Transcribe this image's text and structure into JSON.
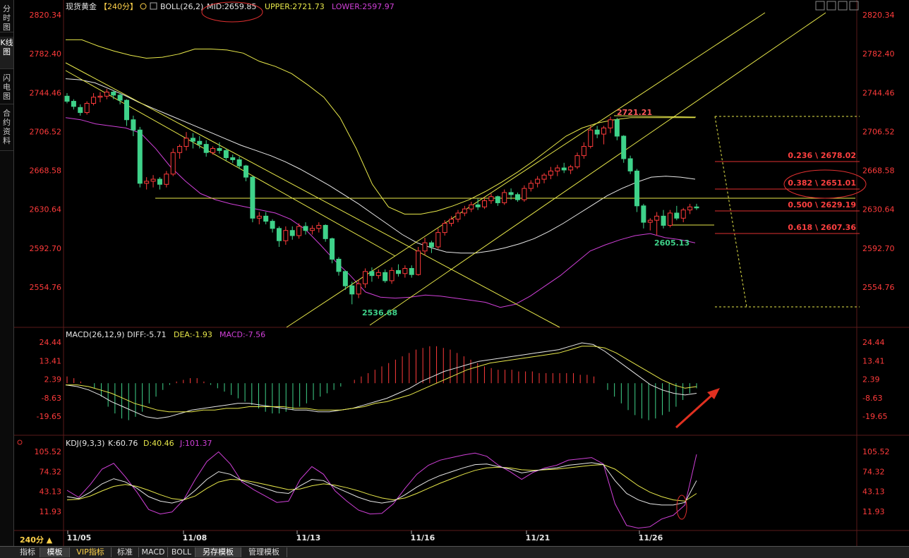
{
  "sidebar": {
    "tabs": [
      "分时图",
      "K线图",
      "闪电图",
      "合约资料"
    ]
  },
  "header": {
    "symbol": "现货黄金",
    "period": "【240分】",
    "boll_name": "BOLL(26,2)",
    "mid": "MID:2659.85",
    "upper": "UPPER:2721.73",
    "lower": "LOWER:2597.97"
  },
  "price_axis": {
    "labels": [
      "2820.34",
      "2782.40",
      "2744.46",
      "2706.52",
      "2668.58",
      "2630.64",
      "2592.70",
      "2554.76"
    ]
  },
  "macd": {
    "name": "MACD(26,12,9)",
    "diff": "DIFF:-5.71",
    "dea": "DEA:-1.93",
    "macd": "MACD:-7.56",
    "axis": [
      "24.44",
      "13.41",
      "2.39",
      "-8.63",
      "-19.65"
    ]
  },
  "kdj": {
    "name": "KDJ(9,3,3)",
    "k": "K:60.76",
    "d": "D:40.46",
    "j": "J:101.37",
    "axis": [
      "105.52",
      "74.32",
      "43.13",
      "11.93"
    ]
  },
  "dates": [
    "11/05",
    "11/08",
    "11/13",
    "11/16",
    "11/21",
    "11/26"
  ],
  "annotations": {
    "high": "2721.21",
    "low": "2536.68",
    "recent_low": "2605.13"
  },
  "fibonacci": [
    {
      "label": "0.236 \\ 2678.02"
    },
    {
      "label": "0.382 \\ 2651.01"
    },
    {
      "label": "0.500 \\ 2629.19"
    },
    {
      "label": "0.618 \\ 2607.36"
    }
  ],
  "period_label": "240分 ▲",
  "bottom_tabs": [
    "指标",
    "模板",
    "VIP指标",
    "标准",
    "MACD",
    "BOLL",
    "另存模板",
    "管理模板"
  ],
  "colors": {
    "up": "#ff3b3b",
    "down": "#3fd28a",
    "yellow": "#e8e84a",
    "magenta": "#d040d8",
    "white": "#e8e8e8",
    "axis": "#ff3b3b"
  },
  "chart_data": {
    "type": "candlestick",
    "candles": [
      [
        2741,
        2744,
        2734,
        2736
      ],
      [
        2736,
        2738,
        2728,
        2731
      ],
      [
        2730,
        2733,
        2722,
        2725
      ],
      [
        2725,
        2736,
        2723,
        2734
      ],
      [
        2734,
        2744,
        2732,
        2740
      ],
      [
        2740,
        2745,
        2735,
        2741
      ],
      [
        2741,
        2748,
        2738,
        2745
      ],
      [
        2745,
        2747,
        2738,
        2742
      ],
      [
        2742,
        2744,
        2733,
        2737
      ],
      [
        2737,
        2738,
        2712,
        2718
      ],
      [
        2718,
        2722,
        2702,
        2708
      ],
      [
        2708,
        2711,
        2652,
        2656
      ],
      [
        2656,
        2662,
        2650,
        2658
      ],
      [
        2658,
        2664,
        2652,
        2660
      ],
      [
        2660,
        2662,
        2650,
        2655
      ],
      [
        2655,
        2668,
        2652,
        2665
      ],
      [
        2665,
        2690,
        2663,
        2686
      ],
      [
        2686,
        2694,
        2680,
        2692
      ],
      [
        2692,
        2706,
        2688,
        2700
      ],
      [
        2700,
        2705,
        2690,
        2697
      ],
      [
        2697,
        2702,
        2690,
        2694
      ],
      [
        2694,
        2698,
        2682,
        2686
      ],
      [
        2686,
        2692,
        2684,
        2690
      ],
      [
        2690,
        2696,
        2685,
        2688
      ],
      [
        2688,
        2690,
        2678,
        2681
      ],
      [
        2681,
        2684,
        2676,
        2679
      ],
      [
        2679,
        2682,
        2670,
        2673
      ],
      [
        2673,
        2674,
        2658,
        2662
      ],
      [
        2662,
        2663,
        2618,
        2622
      ],
      [
        2622,
        2628,
        2616,
        2624
      ],
      [
        2624,
        2628,
        2616,
        2619
      ],
      [
        2619,
        2621,
        2608,
        2612
      ],
      [
        2612,
        2614,
        2594,
        2600
      ],
      [
        2600,
        2614,
        2596,
        2610
      ],
      [
        2610,
        2614,
        2601,
        2605
      ],
      [
        2605,
        2617,
        2602,
        2614
      ],
      [
        2614,
        2618,
        2606,
        2610
      ],
      [
        2610,
        2615,
        2606,
        2612
      ],
      [
        2612,
        2618,
        2608,
        2615
      ],
      [
        2615,
        2616,
        2599,
        2602
      ],
      [
        2602,
        2603,
        2578,
        2582
      ],
      [
        2582,
        2584,
        2566,
        2570
      ],
      [
        2570,
        2571,
        2552,
        2556
      ],
      [
        2556,
        2560,
        2538,
        2548
      ],
      [
        2548,
        2562,
        2544,
        2558
      ],
      [
        2558,
        2573,
        2554,
        2570
      ],
      [
        2570,
        2574,
        2560,
        2566
      ],
      [
        2566,
        2572,
        2563,
        2569
      ],
      [
        2569,
        2572,
        2559,
        2561
      ],
      [
        2561,
        2574,
        2558,
        2571
      ],
      [
        2571,
        2577,
        2565,
        2568
      ],
      [
        2568,
        2576,
        2564,
        2573
      ],
      [
        2573,
        2576,
        2564,
        2567
      ],
      [
        2567,
        2594,
        2566,
        2590
      ],
      [
        2590,
        2603,
        2586,
        2598
      ],
      [
        2598,
        2600,
        2588,
        2594
      ],
      [
        2594,
        2612,
        2592,
        2608
      ],
      [
        2608,
        2620,
        2605,
        2617
      ],
      [
        2617,
        2624,
        2614,
        2621
      ],
      [
        2621,
        2630,
        2618,
        2627
      ],
      [
        2627,
        2634,
        2624,
        2631
      ],
      [
        2631,
        2638,
        2628,
        2635
      ],
      [
        2635,
        2641,
        2630,
        2633
      ],
      [
        2633,
        2642,
        2631,
        2639
      ],
      [
        2639,
        2646,
        2636,
        2643
      ],
      [
        2643,
        2644,
        2634,
        2637
      ],
      [
        2637,
        2650,
        2635,
        2647
      ],
      [
        2647,
        2651,
        2640,
        2645
      ],
      [
        2645,
        2647,
        2638,
        2640
      ],
      [
        2640,
        2654,
        2638,
        2651
      ],
      [
        2651,
        2659,
        2648,
        2656
      ],
      [
        2656,
        2663,
        2652,
        2660
      ],
      [
        2660,
        2666,
        2656,
        2664
      ],
      [
        2664,
        2672,
        2660,
        2668
      ],
      [
        2668,
        2674,
        2663,
        2671
      ],
      [
        2671,
        2676,
        2666,
        2669
      ],
      [
        2669,
        2674,
        2665,
        2672
      ],
      [
        2672,
        2686,
        2670,
        2683
      ],
      [
        2683,
        2696,
        2680,
        2692
      ],
      [
        2692,
        2712,
        2690,
        2708
      ],
      [
        2708,
        2712,
        2700,
        2704
      ],
      [
        2704,
        2712,
        2694,
        2710
      ],
      [
        2710,
        2721,
        2705,
        2718
      ],
      [
        2718,
        2720,
        2698,
        2702
      ],
      [
        2702,
        2703,
        2676,
        2680
      ],
      [
        2680,
        2683,
        2665,
        2668
      ],
      [
        2668,
        2670,
        2628,
        2634
      ],
      [
        2634,
        2636,
        2612,
        2618
      ],
      [
        2618,
        2622,
        2610,
        2620
      ],
      [
        2620,
        2628,
        2605,
        2624
      ],
      [
        2624,
        2630,
        2612,
        2615
      ],
      [
        2615,
        2630,
        2613,
        2627
      ],
      [
        2627,
        2634,
        2620,
        2622
      ],
      [
        2622,
        2632,
        2618,
        2630
      ],
      [
        2630,
        2636,
        2626,
        2633
      ],
      [
        2633,
        2636,
        2630,
        2632
      ]
    ],
    "boll_upper": [
      2796,
      2796,
      2790,
      2785,
      2781,
      2778,
      2779,
      2782,
      2787,
      2787,
      2786,
      2783,
      2775,
      2770,
      2763,
      2752,
      2740,
      2720,
      2690,
      2655,
      2633,
      2626,
      2626,
      2629,
      2634,
      2640,
      2648,
      2657,
      2667,
      2678,
      2690,
      2702,
      2710,
      2715,
      2718,
      2720,
      2720,
      2720,
      2720,
      2720
    ],
    "boll_mid": [
      2758,
      2757,
      2754,
      2748,
      2742,
      2735,
      2729,
      2723,
      2717,
      2711,
      2705,
      2699,
      2693,
      2688,
      2683,
      2677,
      2670,
      2662,
      2654,
      2645,
      2636,
      2626,
      2616,
      2606,
      2598,
      2593,
      2589,
      2588,
      2588,
      2590,
      2593,
      2597,
      2602,
      2609,
      2617,
      2626,
      2635,
      2644,
      2651,
      2657,
      2662,
      2663,
      2662,
      2660
    ],
    "boll_lower": [
      2720,
      2718,
      2714,
      2712,
      2710,
      2705,
      2690,
      2672,
      2658,
      2646,
      2640,
      2636,
      2633,
      2630,
      2627,
      2621,
      2611,
      2596,
      2580,
      2566,
      2550,
      2545,
      2544,
      2545,
      2547,
      2546,
      2544,
      2542,
      2540,
      2535,
      2538,
      2546,
      2556,
      2566,
      2578,
      2590,
      2596,
      2601,
      2605,
      2607,
      2603,
      2601,
      2598
    ],
    "macd_hist": [
      4,
      3,
      1,
      0,
      -3,
      -8,
      -14,
      -18,
      -21,
      -22,
      -20,
      -17,
      -12,
      -8,
      -4,
      -1,
      1,
      2,
      3,
      3,
      1,
      -1,
      -3,
      -5,
      -7,
      -9,
      -11,
      -13,
      -15,
      -17,
      -18,
      -18,
      -17,
      -16,
      -14,
      -12,
      -10,
      -8,
      -6,
      -4,
      -2,
      0,
      2,
      4,
      6,
      8,
      10,
      12,
      14,
      16,
      18,
      20,
      21,
      22,
      22,
      21,
      20,
      18,
      16,
      14,
      12,
      10,
      9,
      8,
      8,
      8,
      7,
      7,
      7,
      6,
      6,
      6,
      6,
      6,
      6,
      5,
      5,
      4,
      0,
      -4,
      -8,
      -12,
      -16,
      -19,
      -21,
      -22,
      -21,
      -19,
      -17,
      -14,
      -10,
      -6,
      -3
    ],
    "macd_diff": [
      -1,
      -2,
      -4,
      -7,
      -11,
      -14,
      -17,
      -20,
      -21,
      -20,
      -18,
      -16,
      -15,
      -14,
      -13,
      -12,
      -12,
      -13,
      -14,
      -15,
      -16,
      -16,
      -17,
      -17,
      -16,
      -15,
      -13,
      -11,
      -9,
      -6,
      -3,
      1,
      4,
      7,
      9,
      11,
      13,
      14,
      15,
      16,
      17,
      18,
      19,
      20,
      22,
      24,
      23,
      19,
      14,
      9,
      4,
      -1,
      -4,
      -6,
      -7,
      -6
    ],
    "macd_dea": [
      -1,
      -1,
      -2,
      -4,
      -6,
      -9,
      -12,
      -14,
      -16,
      -17,
      -17,
      -17,
      -16,
      -16,
      -15,
      -15,
      -14,
      -14,
      -14,
      -14,
      -15,
      -15,
      -16,
      -16,
      -16,
      -15,
      -14,
      -12,
      -11,
      -9,
      -7,
      -4,
      -1,
      2,
      5,
      8,
      10,
      12,
      13,
      14,
      15,
      16,
      17,
      18,
      20,
      22,
      22,
      21,
      18,
      14,
      10,
      6,
      2,
      -1,
      -3,
      -2
    ],
    "kdj_k": [
      35,
      32,
      42,
      55,
      63,
      58,
      48,
      35,
      28,
      25,
      30,
      45,
      62,
      74,
      70,
      60,
      54,
      48,
      42,
      40,
      52,
      62,
      60,
      50,
      42,
      34,
      28,
      25,
      28,
      38,
      50,
      60,
      68,
      74,
      80,
      85,
      86,
      82,
      78,
      72,
      75,
      78,
      80,
      84,
      86,
      88,
      85,
      60,
      40,
      30,
      24,
      22,
      22,
      26,
      60
    ],
    "kdj_d": [
      30,
      31,
      36,
      44,
      51,
      54,
      51,
      45,
      38,
      32,
      30,
      36,
      48,
      58,
      62,
      61,
      58,
      54,
      50,
      46,
      47,
      52,
      55,
      53,
      49,
      44,
      38,
      33,
      30,
      33,
      40,
      48,
      56,
      63,
      70,
      76,
      80,
      81,
      80,
      77,
      76,
      77,
      78,
      80,
      82,
      84,
      85,
      78,
      65,
      52,
      42,
      35,
      30,
      28,
      40
    ],
    "kdj_j": [
      45,
      34,
      54,
      78,
      87,
      66,
      42,
      15,
      8,
      11,
      30,
      62,
      90,
      105,
      86,
      58,
      46,
      36,
      26,
      28,
      62,
      82,
      70,
      44,
      28,
      14,
      8,
      9,
      24,
      48,
      70,
      84,
      92,
      96,
      100,
      103,
      98,
      84,
      74,
      62,
      73,
      80,
      84,
      92,
      94,
      96,
      86,
      24,
      -10,
      -14,
      -12,
      0,
      6,
      22,
      101
    ]
  }
}
